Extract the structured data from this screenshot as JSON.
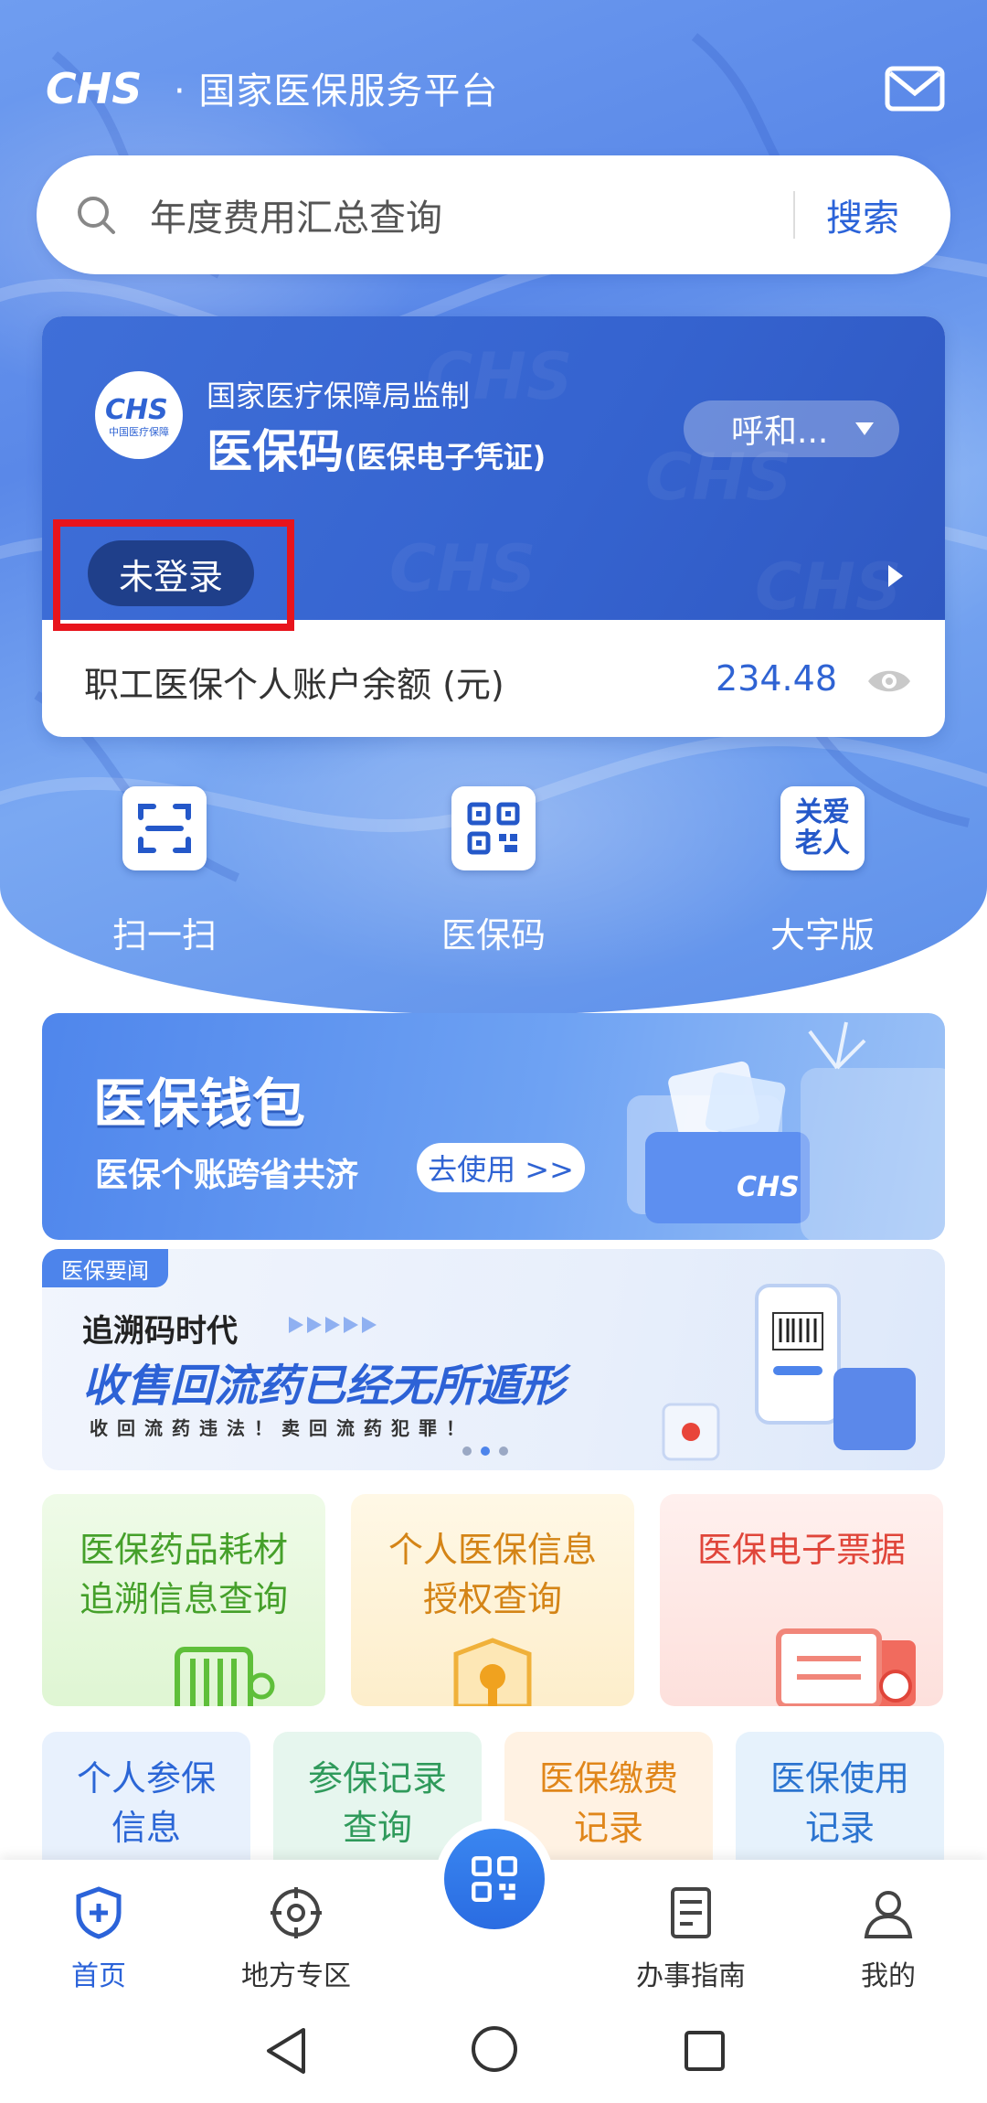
{
  "header": {
    "logo": "CHS",
    "title": "· 国家医保服务平台"
  },
  "search": {
    "placeholder": "年度费用汇总查询",
    "button": "搜索"
  },
  "card": {
    "logo_text": "CHS",
    "logo_sub": "中国医疗保障",
    "supervise": "国家医疗保障局监制",
    "title": "医保码",
    "subtitle": "(医保电子凭证)",
    "region": "呼和...",
    "login_status": "未登录",
    "balance_label": "职工医保个人账户余额 (元)",
    "balance_value": "234.48"
  },
  "quick_actions": [
    {
      "label": "扫一扫",
      "icon": "scan-icon"
    },
    {
      "label": "医保码",
      "icon": "qr-code-icon"
    },
    {
      "label": "大字版",
      "icon": "elder-care-icon",
      "icon_text": "关爱老人"
    }
  ],
  "wallet": {
    "title": "医保钱包",
    "subtitle": "医保个账跨省共济",
    "button": "去使用 >>",
    "card_text": "CHS"
  },
  "news": {
    "tag": "医保要闻",
    "headline": "追溯码时代",
    "main": "收售回流药已经无所遁形",
    "small": "收回流药违法！卖回流药犯罪！",
    "dots": 3,
    "active_dot": 1
  },
  "services_row1": [
    {
      "line1": "医保药品耗材",
      "line2": "追溯信息查询"
    },
    {
      "line1": "个人医保信息",
      "line2": "授权查询"
    },
    {
      "line1": "医保电子票据",
      "line2": ""
    }
  ],
  "services_row2": [
    {
      "line1": "个人参保",
      "line2": "信息"
    },
    {
      "line1": "参保记录",
      "line2": "查询"
    },
    {
      "line1": "医保缴费",
      "line2": "记录"
    },
    {
      "line1": "医保使用",
      "line2": "记录"
    }
  ],
  "bottom_nav": [
    {
      "label": "首页",
      "icon": "home-shield-icon",
      "active": true
    },
    {
      "label": "地方专区",
      "icon": "target-icon"
    },
    {
      "label": "办事指南",
      "icon": "document-icon"
    },
    {
      "label": "我的",
      "icon": "user-icon"
    }
  ],
  "colors": {
    "primary": "#2b63d9",
    "highlight": "#e8141c",
    "card_blue": "#3563cf"
  }
}
